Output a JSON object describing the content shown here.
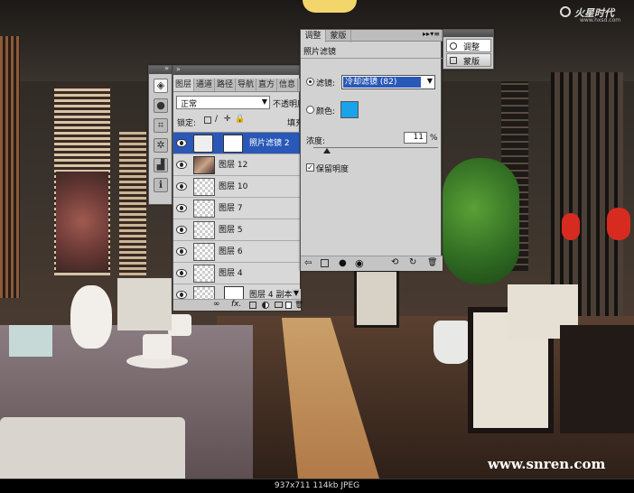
{
  "watermark_top": "火星时代",
  "watermark_url": "www.hxsd.com",
  "watermark_bottom": "www.snren.com",
  "status_bar": "937x711  114kb  JPEG",
  "tools_panel": {
    "icons": [
      "layers-icon",
      "channels-icon",
      "transform-icon",
      "settings-icon",
      "histogram-icon",
      "info-icon"
    ]
  },
  "layers_panel": {
    "tabs": [
      "图层",
      "通道",
      "路径",
      "导航",
      "直方",
      "信息"
    ],
    "blend_mode": "正常",
    "opacity_label": "不透明度",
    "lock_label": "锁定:",
    "fill_label": "填充",
    "layers": [
      {
        "name": "照片滤镜 2",
        "selected": true,
        "type": "adjustment"
      },
      {
        "name": "图层 12",
        "selected": false,
        "type": "image"
      },
      {
        "name": "图层 10",
        "selected": false,
        "type": "pixel"
      },
      {
        "name": "图层 7",
        "selected": false,
        "type": "pixel"
      },
      {
        "name": "图层 5",
        "selected": false,
        "type": "pixel"
      },
      {
        "name": "图层 6",
        "selected": false,
        "type": "pixel"
      },
      {
        "name": "图层 4",
        "selected": false,
        "type": "pixel"
      },
      {
        "name": "图层 4 副本",
        "selected": false,
        "type": "masked"
      }
    ]
  },
  "adjust_panel": {
    "tabs": [
      "调整",
      "蒙版"
    ],
    "title": "照片滤镜",
    "filter_label": "滤镜:",
    "filter_value": "冷却滤镜 (82)",
    "color_label": "颜色:",
    "color_swatch": "#1aa3ea",
    "density_label": "浓度:",
    "density_value": "11",
    "density_unit": "%",
    "preserve_label": "保留明度",
    "preserve_checked": true
  },
  "mini_panel": {
    "items": [
      {
        "label": "调整",
        "icon": "adjust-icon"
      },
      {
        "label": "蒙版",
        "icon": "mask-icon"
      }
    ]
  }
}
